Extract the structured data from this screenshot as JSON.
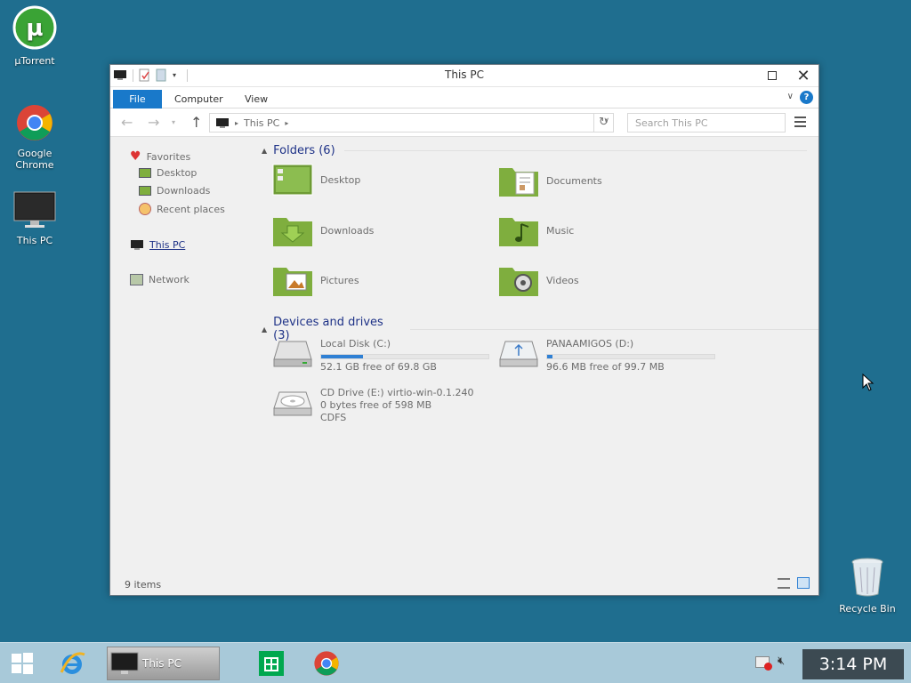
{
  "desktop": {
    "icons": [
      {
        "label": "µTorrent"
      },
      {
        "label": "Google Chrome"
      },
      {
        "label": "This PC"
      },
      {
        "label": "Recycle Bin"
      }
    ]
  },
  "window": {
    "title": "This PC",
    "ribbon_tabs": [
      "File",
      "Computer",
      "View"
    ],
    "address": {
      "crumb": "This PC"
    },
    "search_placeholder": "Search This PC",
    "nav_pane": {
      "favorites": "Favorites",
      "desktop": "Desktop",
      "downloads": "Downloads",
      "recent": "Recent places",
      "this_pc": "This PC",
      "network": "Network"
    },
    "folders_header": "Folders (6)",
    "folders": [
      "Desktop",
      "Documents",
      "Downloads",
      "Music",
      "Pictures",
      "Videos"
    ],
    "drives_header": "Devices and drives (3)",
    "drives": [
      {
        "name": "Local Disk (C:)",
        "detail": "52.1 GB free of 69.8 GB",
        "used_fraction": 0.25
      },
      {
        "name": "PANAAMIGOS (D:)",
        "detail": "96.6 MB free of 99.7 MB",
        "used_fraction": 0.03
      },
      {
        "name": "CD Drive (E:) virtio-win-0.1.240",
        "detail": "0 bytes free of 598 MB",
        "detail2": "CDFS"
      }
    ],
    "status": "9 items"
  },
  "taskbar": {
    "active_window": "This PC",
    "clock": "3:14 PM"
  },
  "colors": {
    "accent": "#1979ca",
    "desktop": "#1f6e8f",
    "folder_green": "#7fae3e"
  }
}
